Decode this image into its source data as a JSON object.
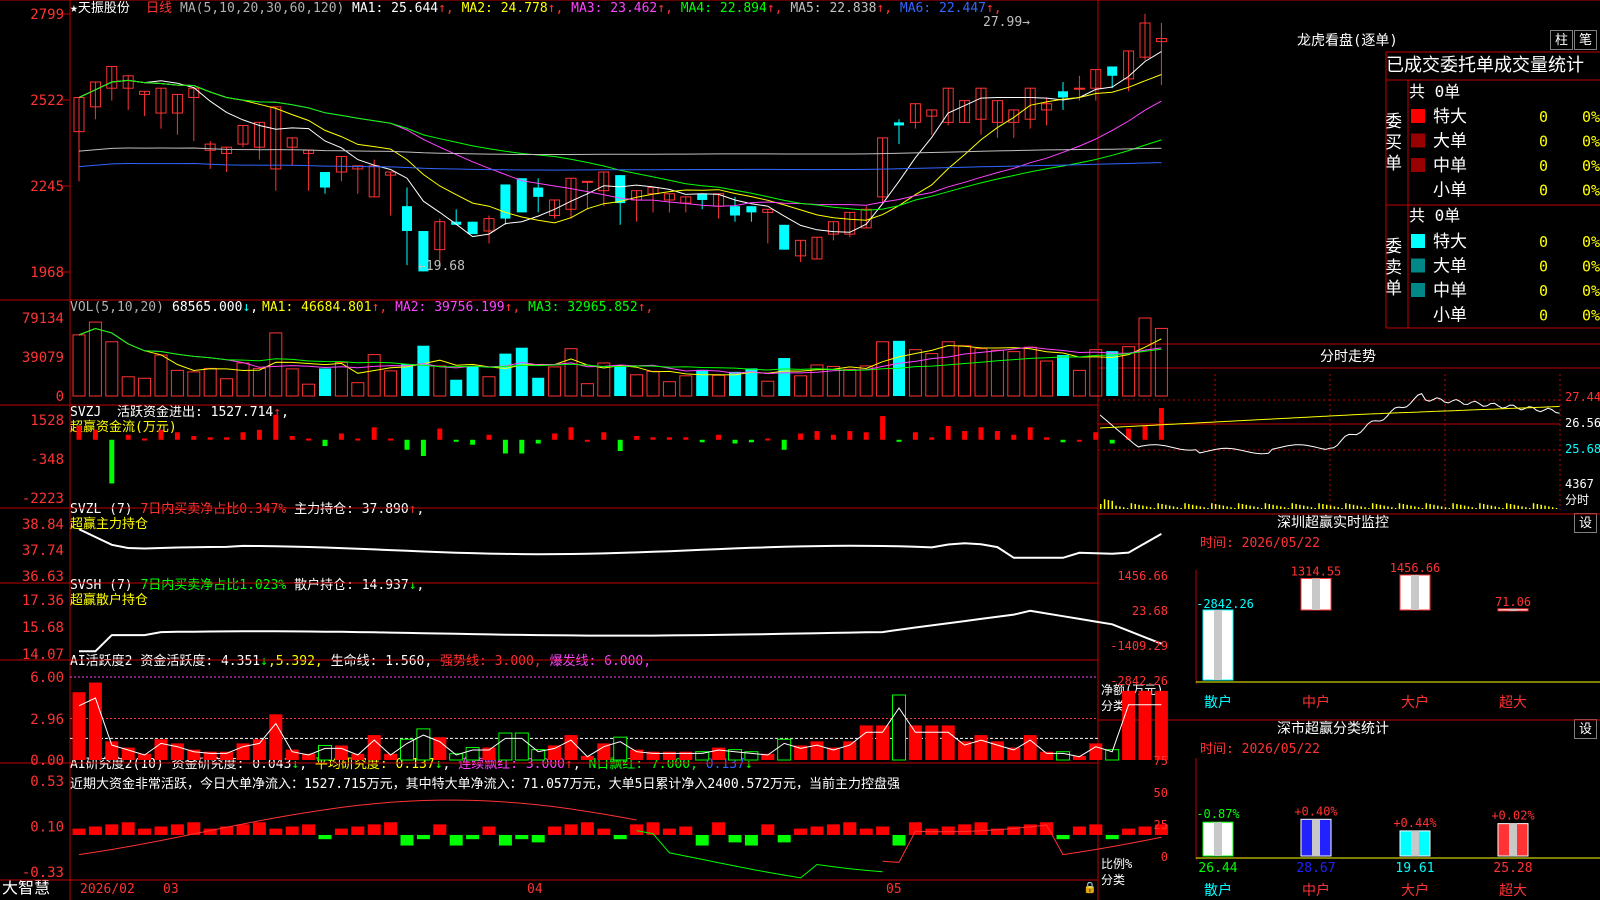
{
  "kline": {
    "title": "★天振股份",
    "period": "日线",
    "ma_label": "MA(5,10,20,30,60,120)",
    "ma": [
      {
        "name": "MA1:",
        "value": "25.644",
        "arrow": "↑",
        "color": "#ffffff"
      },
      {
        "name": "MA2:",
        "value": "24.778",
        "arrow": "↑",
        "color": "#ffff00"
      },
      {
        "name": "MA3:",
        "value": "23.462",
        "arrow": "↑",
        "color": "#ff44ff"
      },
      {
        "name": "MA4:",
        "value": "22.894",
        "arrow": "↑",
        "color": "#00ff00"
      },
      {
        "name": "MA5:",
        "value": "22.838",
        "arrow": "↑",
        "color": "#c0c0c0"
      },
      {
        "name": "MA6:",
        "value": "22.447",
        "arrow": "↑",
        "color": "#3366ff"
      }
    ],
    "y_ticks": [
      "2799",
      "2522",
      "2245",
      "1968"
    ],
    "y_tick_values": [
      27.99,
      25.22,
      22.45,
      19.68
    ],
    "high_label": "27.99",
    "low_label": "19.68",
    "candles": [
      [
        24.2,
        25.3,
        24.9,
        22.6
      ],
      [
        25.0,
        25.8,
        25.4,
        24.6
      ],
      [
        25.6,
        26.3,
        25.8,
        25.2
      ],
      [
        25.6,
        26.0,
        25.8,
        24.9
      ],
      [
        25.4,
        25.5,
        25.2,
        24.7
      ],
      [
        24.8,
        25.6,
        24.5,
        24.3
      ],
      [
        24.8,
        25.4,
        24.7,
        24.1
      ],
      [
        25.3,
        25.6,
        24.0,
        23.9
      ],
      [
        23.6,
        23.8,
        23.9,
        23.0
      ],
      [
        23.5,
        23.7,
        23.7,
        22.9
      ],
      [
        23.8,
        24.4,
        23.8,
        23.7
      ],
      [
        23.7,
        24.5,
        23.4,
        23.3
      ],
      [
        23.0,
        25.0,
        23.3,
        22.3
      ],
      [
        23.7,
        24.0,
        23.8,
        23.1
      ],
      [
        23.5,
        23.6,
        23.1,
        22.3
      ],
      [
        22.9,
        22.4,
        22.9,
        22.2
      ],
      [
        22.9,
        23.4,
        23.1,
        22.6
      ],
      [
        23.0,
        23.1,
        23.0,
        22.2
      ],
      [
        22.1,
        23.1,
        23.3,
        22.1
      ],
      [
        22.8,
        22.9,
        22.7,
        21.5
      ],
      [
        21.8,
        21.0,
        22.4,
        19.9
      ],
      [
        21.0,
        19.7,
        21.0,
        19.7
      ],
      [
        20.4,
        21.3,
        21.4,
        20.0
      ],
      [
        21.3,
        21.2,
        21.7,
        21.3
      ],
      [
        21.3,
        20.9,
        21.3,
        21.2
      ],
      [
        21.0,
        21.4,
        21.5,
        20.6
      ],
      [
        22.5,
        21.4,
        22.3,
        21.2
      ],
      [
        22.7,
        21.6,
        22.2,
        21.8
      ],
      [
        22.4,
        22.1,
        22.7,
        21.6
      ],
      [
        21.5,
        22.0,
        21.7,
        21.4
      ],
      [
        21.7,
        22.7,
        21.4,
        21.4
      ],
      [
        22.6,
        22.6,
        22.0,
        21.7
      ],
      [
        22.3,
        22.9,
        22.6,
        21.8
      ],
      [
        22.8,
        21.9,
        21.2,
        21.6
      ],
      [
        22.0,
        22.3,
        21.9,
        21.3
      ],
      [
        22.2,
        22.4,
        22.0,
        21.6
      ],
      [
        22.0,
        22.2,
        21.6,
        21.6
      ],
      [
        21.9,
        22.1,
        21.6,
        21.7
      ],
      [
        22.2,
        22.0,
        22.1,
        21.7
      ],
      [
        21.8,
        22.2,
        22.2,
        21.4
      ],
      [
        21.8,
        21.5,
        22.1,
        21.3
      ],
      [
        21.8,
        21.6,
        21.4,
        21.3
      ],
      [
        21.6,
        21.7,
        21.2,
        20.6
      ],
      [
        21.2,
        20.4,
        21.2,
        20.6
      ],
      [
        20.2,
        20.7,
        20.6,
        20.0
      ],
      [
        20.1,
        20.8,
        20.6,
        20.1
      ],
      [
        20.9,
        21.3,
        20.7,
        20.7
      ],
      [
        20.9,
        21.6,
        20.9,
        20.8
      ],
      [
        21.1,
        21.7,
        21.8,
        21.2
      ],
      [
        22.1,
        24.0,
        23.8,
        21.9
      ],
      [
        24.5,
        24.4,
        24.6,
        23.8
      ],
      [
        24.5,
        25.1,
        24.3,
        24.3
      ],
      [
        24.7,
        24.9,
        24.6,
        24.1
      ],
      [
        24.5,
        25.6,
        24.8,
        24.4
      ],
      [
        24.5,
        25.2,
        24.9,
        24.5
      ],
      [
        24.6,
        25.6,
        24.5,
        24.1
      ],
      [
        24.5,
        25.2,
        24.4,
        24.0
      ],
      [
        24.5,
        24.9,
        24.4,
        24.0
      ],
      [
        24.6,
        25.6,
        25.0,
        24.3
      ],
      [
        24.9,
        25.1,
        25.3,
        24.4
      ],
      [
        25.5,
        25.3,
        25.8,
        24.9
      ],
      [
        25.6,
        25.6,
        26.0,
        25.2
      ],
      [
        25.6,
        26.2,
        25.8,
        25.2
      ],
      [
        26.3,
        26.0,
        25.9,
        25.6
      ],
      [
        25.9,
        26.8,
        26.6,
        25.5
      ],
      [
        26.6,
        27.7,
        28.0,
        26.5
      ],
      [
        27.1,
        27.2,
        27.7,
        25.7
      ]
    ]
  },
  "vol": {
    "label": "VOL(5,10,20)",
    "value": "68565.000",
    "value_arrow": "↓",
    "ma": [
      {
        "name": "MA1:",
        "value": "46684.801",
        "arrow": "↑",
        "color": "#ffff00"
      },
      {
        "name": "MA2:",
        "value": "39756.199",
        "arrow": "↑",
        "color": "#ff44ff"
      },
      {
        "name": "MA3:",
        "value": "32965.852",
        "arrow": "↑",
        "color": "#00ff00"
      }
    ],
    "y_ticks": [
      "79134",
      "39079",
      "0"
    ]
  },
  "svzj": {
    "label": "SVZJ",
    "name": "活跃资金进出:",
    "value": "1527.714",
    "arrow": "↑",
    "title": "超赢资金流(万元)",
    "y_ticks": [
      "1528",
      "-348",
      "-2223"
    ]
  },
  "svzl": {
    "label": "SVZL (7)",
    "ratio_text": "7日内买卖净占比0.347%",
    "name": "主力持仓:",
    "value": "37.890",
    "arrow": "↑",
    "title": "超赢主力持仓",
    "y_ticks": [
      "38.84",
      "37.74",
      "36.63"
    ]
  },
  "svsh": {
    "label": "SVSH (7)",
    "ratio_text": "7日内买卖净占比1.023%",
    "name": "散户持仓:",
    "value": "14.937",
    "arrow": "↓",
    "title": "超赢散户持仓",
    "y_ticks": [
      "17.36",
      "15.68",
      "14.07"
    ]
  },
  "ai_active": {
    "label": "AI活跃度2",
    "name": "资金活跃度:",
    "v1": "4.351",
    "a1": "↓",
    "v2": "5.392",
    "lifeline": "生命线: 1.560,",
    "strong": "强势线: 3.000,",
    "burst": "爆发线: 6.000,",
    "y_ticks": [
      "6.00",
      "2.96",
      "0.00"
    ]
  },
  "ai_research": {
    "label": "AI研究度2(10)",
    "name": "资金研究度:",
    "v1": "0.043",
    "a1": "↓",
    "avg": "平均研究度: 0.137",
    "a2": "↓",
    "lianxu": "连续飘红: 3.000",
    "a3": "↑",
    "nri": "N日飘红: 7.000,",
    "v4": "0.137",
    "a4": "↓",
    "summary": "近期大资金非常活跃，今日大单净流入：1527.715万元，其中特大单净流入：71.057万元，大单5日累计净入2400.572万元，当前主力控盘强",
    "y_ticks": [
      "0.53",
      "0.10",
      "-0.33"
    ]
  },
  "bottom_axis": {
    "brand": "大智慧",
    "labels": [
      "2026/02",
      "03",
      "04",
      "05"
    ]
  },
  "right": {
    "longhu_title": "龙虎看盘(逐单)",
    "btn_zhu": "柱",
    "btn_bi": "笔",
    "stats_header": "已成交委托单成交量统计",
    "buy_group_label": "委买单",
    "sell_group_label": "委卖单",
    "buy_total": "共 0单",
    "sell_total": "共 0单",
    "buy_rows": [
      {
        "name": "特大",
        "count": "0",
        "pct": "0%",
        "color": "#ff0000"
      },
      {
        "name": "大单",
        "count": "0",
        "pct": "0%",
        "color": "#990000"
      },
      {
        "name": "中单",
        "count": "0",
        "pct": "0%",
        "color": "#990000"
      },
      {
        "name": "小单",
        "count": "0",
        "pct": "0%",
        "color": "#000000"
      }
    ],
    "sell_rows": [
      {
        "name": "特大",
        "count": "0",
        "pct": "0%",
        "color": "#00ffff"
      },
      {
        "name": "大单",
        "count": "0",
        "pct": "0%",
        "color": "#008888"
      },
      {
        "name": "中单",
        "count": "0",
        "pct": "0%",
        "color": "#008888"
      },
      {
        "name": "小单",
        "count": "0",
        "pct": "0%",
        "color": "#000000"
      }
    ],
    "fenshi_title": "分时走势",
    "fenshi_ticks": [
      "27.44",
      "26.56",
      "25.68"
    ],
    "fenshi_vol": "4367",
    "fenshi_unit": "分时",
    "monitor_title": "深圳超赢实时监控",
    "btn_set": "设",
    "monitor_time": "时间: 2026/05/22",
    "monitor_ticks": [
      "1456.66",
      "23.68",
      "-1409.29",
      "-2842.26"
    ],
    "monitor_axis_name": "净额(万元)",
    "monitor_axis_name2": "分类",
    "classify_title": "深市超赢分类统计",
    "classify_time": "时间: 2026/05/22",
    "classify_ticks": [
      "75",
      "50",
      "25",
      "0"
    ],
    "classify_axis_name": "比例%",
    "classify_axis_name2": "分类",
    "categories": [
      "散户",
      "中户",
      "大户",
      "超大"
    ]
  },
  "chart_data": [
    {
      "type": "bar",
      "title": "深圳超赢实时监控",
      "ylabel": "净额(万元)",
      "xlabel": "分类",
      "categories": [
        "散户",
        "中户",
        "大户",
        "超大"
      ],
      "values": [
        -2842.26,
        1314.55,
        1456.66,
        71.06
      ],
      "ylim": [
        -2842.26,
        1456.66
      ]
    },
    {
      "type": "bar",
      "title": "深市超赢分类统计",
      "ylabel": "比例%",
      "xlabel": "分类",
      "categories": [
        "散户",
        "中户",
        "大户",
        "超大"
      ],
      "values": [
        26.44,
        28.67,
        19.61,
        25.28
      ],
      "changes": [
        "-0.87%",
        "+0.40%",
        "+0.44%",
        "+0.02%"
      ],
      "ylim": [
        0,
        75
      ]
    }
  ]
}
